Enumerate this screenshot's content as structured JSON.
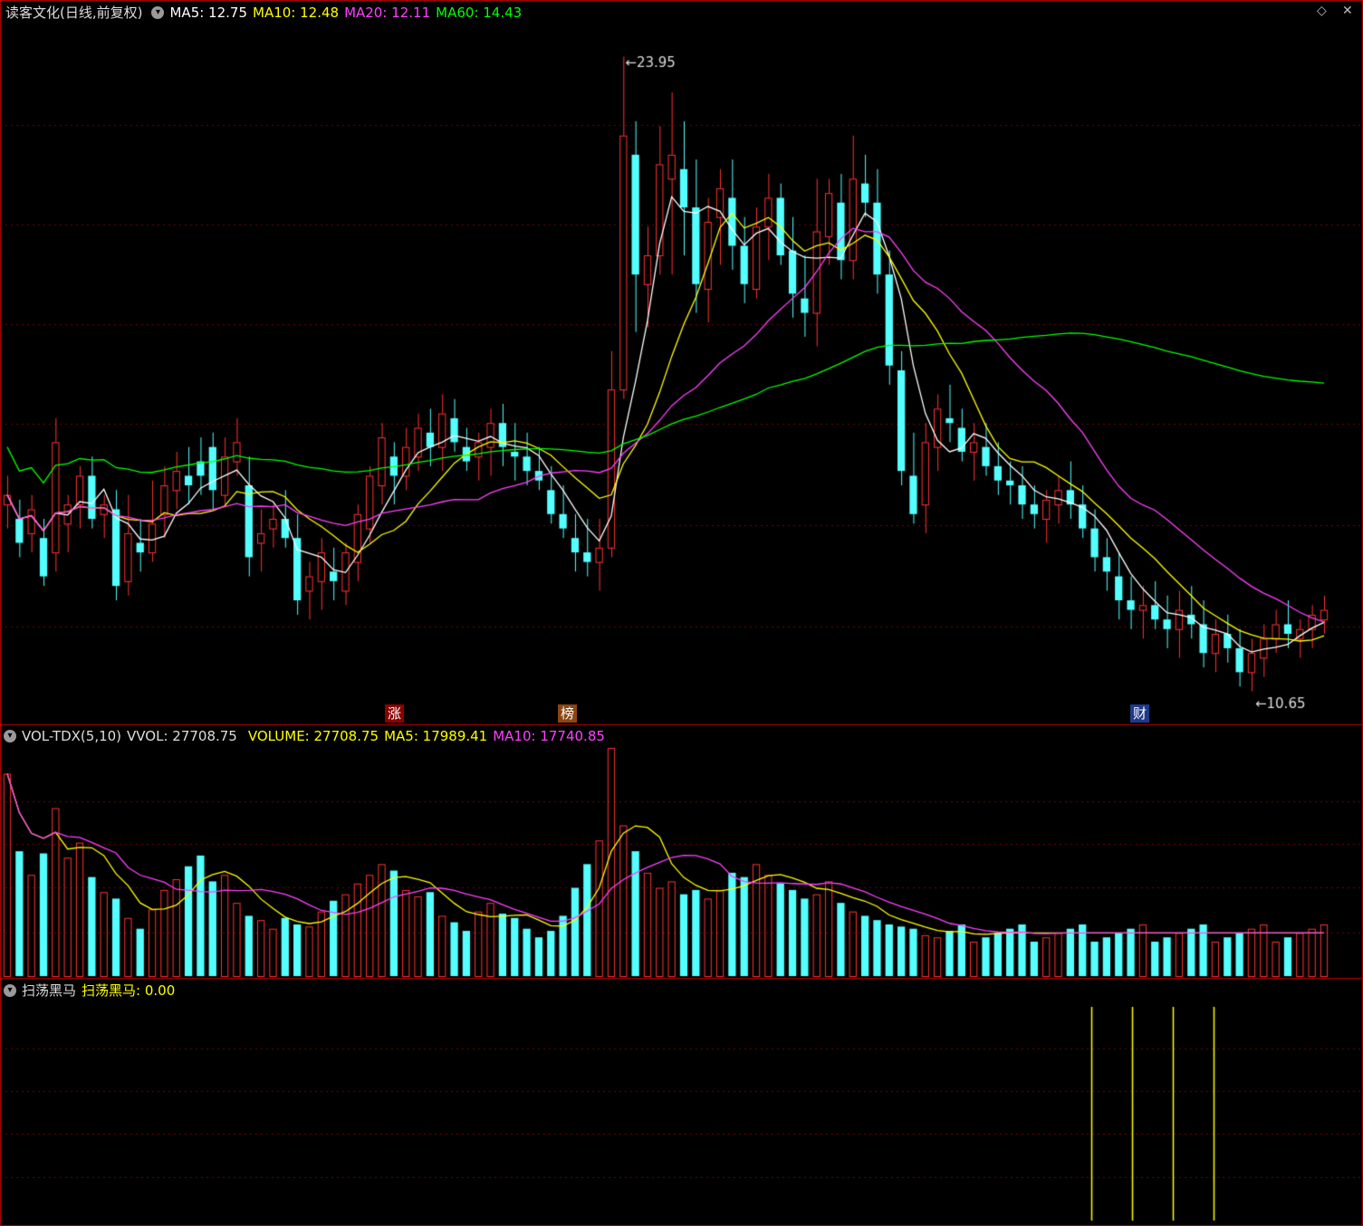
{
  "header": {
    "title": "读客文化(日线,前复权)",
    "ma_items": [
      {
        "label": "MA5: 12.75",
        "color": "#ffffff"
      },
      {
        "label": "MA10: 12.48",
        "color": "#ffff00"
      },
      {
        "label": "MA20: 12.11",
        "color": "#ff40ff"
      },
      {
        "label": "MA60: 14.43",
        "color": "#00ff00"
      }
    ]
  },
  "vol_header": {
    "name": "VOL-TDX(5,10)",
    "vvol": "VVOL: 27708.75",
    "volume": "VOLUME: 27708.75",
    "ma5": "MA5: 17989.41",
    "ma10": "MA10: 17740.85"
  },
  "ind_header": {
    "name": "扫荡黑马",
    "value": "扫荡黑马: 0.00"
  },
  "tags": [
    {
      "text": "涨",
      "bg": "#8b0000"
    },
    {
      "text": "榜",
      "bg": "#8b4513"
    },
    {
      "text": "财",
      "bg": "#1e3a8a"
    }
  ],
  "icons": {
    "collapse": "chevron-down-icon",
    "window": "diamond-icon",
    "close": "close-icon"
  },
  "colors": {
    "up": "#ff3232",
    "down": "#54ffff",
    "ma5": "#ffffff",
    "ma10": "#ffff00",
    "ma20": "#ff40ff",
    "ma60": "#00ff00",
    "grid": "#7a0000",
    "indicator": "#ffff00"
  },
  "chart_data": {
    "type": "candlestick",
    "high_label": "23.95",
    "low_label": "10.65",
    "y_range": [
      10.2,
      24.6
    ],
    "ohlc": [
      [
        14.6,
        15.2,
        14.1,
        14.8
      ],
      [
        14.3,
        14.7,
        13.5,
        13.8
      ],
      [
        14.0,
        14.8,
        13.6,
        14.5
      ],
      [
        13.9,
        14.3,
        12.9,
        13.1
      ],
      [
        13.6,
        16.4,
        13.2,
        15.9
      ],
      [
        14.2,
        14.8,
        13.6,
        14.6
      ],
      [
        14.6,
        15.4,
        14.1,
        15.2
      ],
      [
        15.2,
        15.6,
        14.1,
        14.3
      ],
      [
        14.4,
        14.8,
        13.9,
        14.6
      ],
      [
        14.5,
        14.9,
        12.6,
        12.9
      ],
      [
        13.0,
        14.8,
        12.7,
        14.0
      ],
      [
        13.8,
        14.3,
        13.2,
        13.6
      ],
      [
        13.6,
        15.1,
        13.4,
        14.2
      ],
      [
        14.4,
        15.4,
        13.9,
        15.0
      ],
      [
        14.9,
        15.7,
        14.5,
        15.3
      ],
      [
        15.2,
        15.8,
        14.6,
        15.0
      ],
      [
        15.5,
        16.0,
        14.8,
        15.2
      ],
      [
        15.8,
        16.1,
        14.5,
        14.9
      ],
      [
        14.8,
        16.0,
        14.6,
        15.6
      ],
      [
        15.5,
        16.4,
        15.2,
        15.9
      ],
      [
        15.0,
        15.6,
        13.1,
        13.5
      ],
      [
        13.8,
        14.5,
        13.2,
        14.0
      ],
      [
        14.1,
        14.6,
        13.7,
        14.3
      ],
      [
        14.3,
        14.9,
        13.7,
        13.9
      ],
      [
        13.9,
        14.4,
        12.3,
        12.6
      ],
      [
        12.8,
        13.4,
        12.2,
        13.1
      ],
      [
        13.0,
        13.9,
        12.4,
        13.6
      ],
      [
        13.2,
        13.7,
        12.6,
        13.0
      ],
      [
        12.8,
        13.8,
        12.5,
        13.6
      ],
      [
        13.4,
        14.6,
        13.0,
        14.4
      ],
      [
        14.1,
        15.4,
        13.8,
        15.2
      ],
      [
        15.0,
        16.3,
        14.6,
        16.0
      ],
      [
        15.6,
        15.9,
        14.6,
        15.2
      ],
      [
        15.2,
        16.2,
        14.9,
        15.8
      ],
      [
        15.6,
        16.5,
        15.3,
        16.2
      ],
      [
        16.1,
        16.6,
        15.4,
        15.8
      ],
      [
        15.8,
        16.9,
        15.3,
        16.5
      ],
      [
        16.4,
        16.8,
        15.7,
        15.9
      ],
      [
        15.8,
        16.2,
        15.3,
        15.5
      ],
      [
        15.6,
        16.1,
        15.1,
        15.9
      ],
      [
        15.8,
        16.6,
        15.2,
        16.3
      ],
      [
        16.3,
        16.7,
        15.4,
        15.8
      ],
      [
        15.7,
        16.3,
        15.1,
        15.6
      ],
      [
        15.6,
        16.1,
        15.0,
        15.3
      ],
      [
        15.3,
        15.8,
        14.9,
        15.1
      ],
      [
        14.9,
        15.4,
        14.2,
        14.4
      ],
      [
        14.4,
        15.0,
        13.9,
        14.1
      ],
      [
        13.9,
        14.4,
        13.2,
        13.6
      ],
      [
        13.6,
        14.3,
        13.1,
        13.4
      ],
      [
        13.4,
        14.3,
        12.8,
        13.7
      ],
      [
        13.7,
        17.8,
        13.5,
        17.0
      ],
      [
        17.0,
        23.95,
        16.8,
        22.3
      ],
      [
        21.9,
        22.6,
        18.2,
        19.4
      ],
      [
        19.2,
        20.4,
        18.3,
        19.8
      ],
      [
        19.8,
        22.5,
        19.4,
        21.7
      ],
      [
        21.4,
        23.2,
        19.4,
        21.9
      ],
      [
        21.6,
        22.6,
        19.8,
        20.8
      ],
      [
        20.8,
        21.8,
        18.6,
        19.2
      ],
      [
        19.1,
        21.0,
        18.4,
        20.5
      ],
      [
        20.6,
        21.6,
        19.6,
        21.2
      ],
      [
        21.0,
        21.8,
        19.5,
        20.0
      ],
      [
        20.0,
        20.6,
        18.8,
        19.2
      ],
      [
        19.1,
        20.8,
        18.9,
        20.4
      ],
      [
        20.4,
        21.5,
        19.7,
        21.0
      ],
      [
        21.0,
        21.3,
        19.6,
        19.8
      ],
      [
        19.9,
        20.6,
        18.5,
        19.0
      ],
      [
        18.9,
        19.8,
        18.1,
        18.6
      ],
      [
        18.6,
        21.4,
        17.9,
        20.3
      ],
      [
        20.2,
        21.4,
        19.6,
        21.1
      ],
      [
        20.9,
        21.5,
        19.3,
        19.7
      ],
      [
        19.7,
        22.3,
        19.3,
        21.4
      ],
      [
        21.3,
        21.9,
        20.6,
        20.9
      ],
      [
        20.9,
        21.6,
        19.0,
        19.4
      ],
      [
        19.4,
        19.9,
        17.1,
        17.5
      ],
      [
        17.4,
        17.8,
        15.0,
        15.3
      ],
      [
        15.2,
        16.1,
        14.2,
        14.4
      ],
      [
        14.6,
        16.3,
        14.0,
        15.9
      ],
      [
        15.8,
        16.9,
        15.3,
        16.6
      ],
      [
        16.4,
        17.1,
        15.9,
        16.3
      ],
      [
        16.2,
        16.6,
        15.5,
        15.7
      ]
    ],
    "ohlc_tail": [
      [
        15.7,
        16.3,
        15.1,
        15.9
      ],
      [
        15.8,
        16.3,
        15.2,
        15.4
      ],
      [
        15.4,
        15.9,
        14.8,
        15.1
      ],
      [
        15.1,
        15.5,
        14.6,
        15.0
      ],
      [
        15.0,
        15.4,
        14.3,
        14.6
      ],
      [
        14.6,
        15.0,
        14.1,
        14.4
      ],
      [
        14.3,
        14.9,
        13.8,
        14.7
      ],
      [
        14.6,
        15.2,
        14.2,
        14.9
      ],
      [
        14.9,
        15.5,
        14.3,
        14.6
      ],
      [
        14.6,
        15.0,
        13.9,
        14.1
      ],
      [
        14.1,
        14.5,
        13.2,
        13.5
      ],
      [
        13.5,
        13.9,
        12.8,
        13.2
      ],
      [
        13.1,
        13.6,
        12.2,
        12.6
      ],
      [
        12.6,
        13.1,
        12.0,
        12.4
      ],
      [
        12.4,
        12.9,
        11.8,
        12.5
      ],
      [
        12.5,
        13.0,
        12.0,
        12.2
      ],
      [
        12.2,
        12.7,
        11.6,
        12.0
      ],
      [
        12.0,
        12.8,
        11.4,
        12.4
      ],
      [
        12.3,
        12.9,
        11.8,
        12.1
      ],
      [
        12.1,
        12.6,
        11.2,
        11.5
      ],
      [
        11.5,
        12.2,
        11.1,
        11.9
      ],
      [
        11.9,
        12.3,
        11.3,
        11.6
      ],
      [
        11.6,
        12.0,
        10.8,
        11.1
      ],
      [
        11.1,
        11.8,
        10.7,
        11.5
      ],
      [
        11.4,
        12.1,
        11.0,
        11.8
      ],
      [
        11.8,
        12.4,
        11.5,
        12.1
      ],
      [
        12.1,
        12.6,
        11.6,
        11.9
      ],
      [
        11.8,
        12.2,
        11.4,
        12.0
      ],
      [
        12.0,
        12.5,
        11.6,
        12.3
      ],
      [
        12.2,
        12.7,
        11.9,
        12.4
      ]
    ],
    "volume": [
      94,
      58,
      47,
      57,
      78,
      55,
      62,
      46,
      39,
      36,
      27,
      22,
      31,
      40,
      45,
      51,
      56,
      44,
      47,
      34,
      28,
      26,
      22,
      27,
      24,
      23,
      30,
      35,
      38,
      43,
      47,
      52,
      49,
      40,
      37,
      39,
      28,
      25,
      21,
      30,
      34,
      29,
      27,
      22,
      18,
      21,
      28,
      41,
      52,
      63,
      106,
      70,
      58,
      48,
      41,
      44,
      38,
      40,
      36,
      40,
      48,
      46,
      52,
      47,
      43,
      40,
      36,
      38,
      44,
      34,
      30,
      28,
      26,
      24,
      23,
      22,
      19,
      18,
      21,
      24
    ],
    "indicator_spikes": [
      1205,
      1250,
      1295,
      1340
    ]
  }
}
